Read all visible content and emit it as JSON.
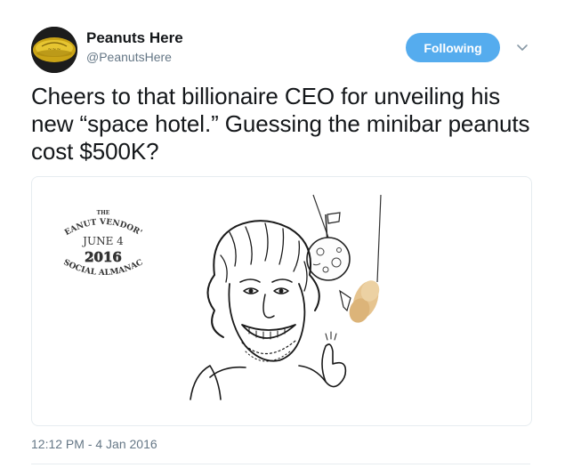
{
  "user": {
    "display_name": "Peanuts Here",
    "handle": "@PeanutsHere"
  },
  "follow_button": {
    "label": "Following",
    "color": "#55acee"
  },
  "tweet": {
    "text": "Cheers to that billionaire CEO for unveiling his new “space hotel.” Guessing the minibar peanuts cost $500K?",
    "timestamp": "12:12 PM - 4 Jan 2016"
  },
  "media": {
    "stamp": {
      "line1": "THE",
      "line2": "PEANUT VENDOR'S",
      "line3": "JUNE 4",
      "line4": "2016",
      "line5": "SOCIAL ALMANAC"
    }
  },
  "icons": {
    "avatar": "peanut-logo-icon",
    "caret": "chevron-down-icon"
  }
}
